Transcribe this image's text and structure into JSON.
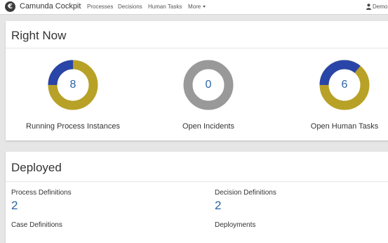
{
  "navbar": {
    "brand": "Camunda Cockpit",
    "logo_glyph": "€",
    "links": [
      {
        "label": "Processes"
      },
      {
        "label": "Decisions"
      },
      {
        "label": "Human Tasks"
      },
      {
        "label": "More"
      }
    ],
    "user": "Demo"
  },
  "right_now": {
    "title": "Right Now",
    "stats": [
      {
        "value": "8",
        "label": "Running Process Instances",
        "fraction_blue": 0.25
      },
      {
        "value": "0",
        "label": "Open Incidents",
        "fraction_blue": 0
      },
      {
        "value": "6",
        "label": "Open Human Tasks",
        "fraction_blue": 0.36
      }
    ]
  },
  "deployed": {
    "title": "Deployed",
    "items": [
      {
        "label": "Process Definitions",
        "value": "2"
      },
      {
        "label": "Decision Definitions",
        "value": "2"
      },
      {
        "label": "Case Definitions",
        "value": ""
      },
      {
        "label": "Deployments",
        "value": ""
      }
    ]
  },
  "colors": {
    "donut_blue": "#2a45a8",
    "donut_gold": "#b8a127",
    "donut_gray": "#999999",
    "accent_value": "#2c64a5"
  }
}
